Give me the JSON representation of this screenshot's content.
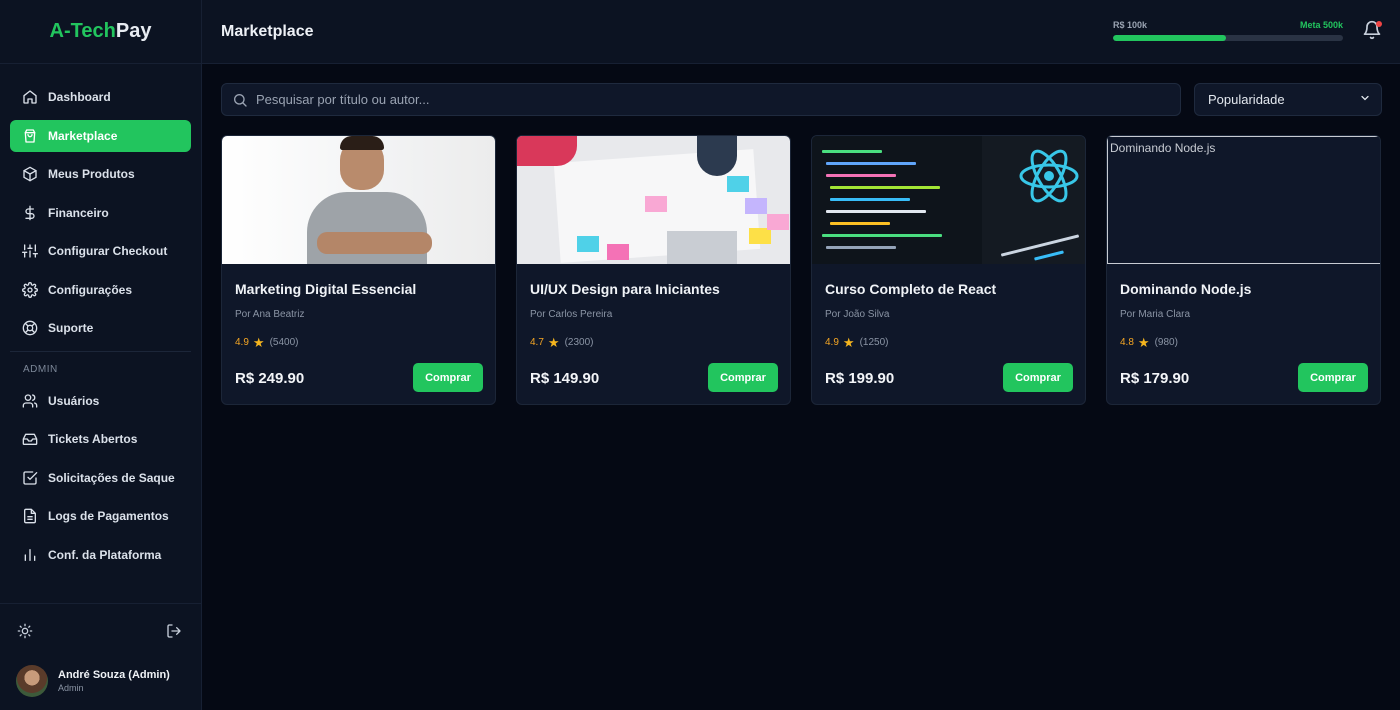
{
  "brand": {
    "part1": "A-Tech",
    "part2": "Pay"
  },
  "header": {
    "title": "Marketplace",
    "goal_current_label": "R$ 100k",
    "goal_target_label": "Meta 500k",
    "goal_progress": 0.49
  },
  "sidebar": {
    "items": [
      {
        "label": "Dashboard",
        "icon": "home-icon"
      },
      {
        "label": "Marketplace",
        "icon": "shopping-bag-icon",
        "active": true
      },
      {
        "label": "Meus Produtos",
        "icon": "box-icon"
      },
      {
        "label": "Financeiro",
        "icon": "dollar-icon"
      },
      {
        "label": "Configurar Checkout",
        "icon": "sliders-icon"
      },
      {
        "label": "Configurações",
        "icon": "gear-icon"
      },
      {
        "label": "Suporte",
        "icon": "lifebuoy-icon"
      }
    ],
    "admin_section_label": "ADMIN",
    "admin_items": [
      {
        "label": "Usuários",
        "icon": "users-icon"
      },
      {
        "label": "Tickets Abertos",
        "icon": "inbox-icon"
      },
      {
        "label": "Solicitações de Saque",
        "icon": "checkbox-icon"
      },
      {
        "label": "Logs de Pagamentos",
        "icon": "document-icon"
      },
      {
        "label": "Conf. da Plataforma",
        "icon": "bar-chart-icon"
      }
    ],
    "user": {
      "name": "André Souza (Admin)",
      "role": "Admin"
    }
  },
  "search": {
    "placeholder": "Pesquisar por título ou autor...",
    "value": ""
  },
  "sort": {
    "selected": "Popularidade"
  },
  "products": [
    {
      "title": "Marketing Digital Essencial",
      "author": "Por Ana Beatriz",
      "rating": "4.9",
      "reviews": "(5400)",
      "price": "R$ 249.90",
      "buy_label": "Comprar"
    },
    {
      "title": "UI/UX Design para Iniciantes",
      "author": "Por Carlos Pereira",
      "rating": "4.7",
      "reviews": "(2300)",
      "price": "R$ 149.90",
      "buy_label": "Comprar"
    },
    {
      "title": "Curso Completo de React",
      "author": "Por João Silva",
      "rating": "4.9",
      "reviews": "(1250)",
      "price": "R$ 199.90",
      "buy_label": "Comprar"
    },
    {
      "title": "Dominando Node.js",
      "author": "Por Maria Clara",
      "rating": "4.8",
      "reviews": "(980)",
      "price": "R$ 179.90",
      "buy_label": "Comprar",
      "image_alt": "Dominando Node.js"
    }
  ],
  "colors": {
    "accent": "#22c55e",
    "background": "#050914",
    "panel": "#0c1322",
    "star": "#f5b51e"
  }
}
